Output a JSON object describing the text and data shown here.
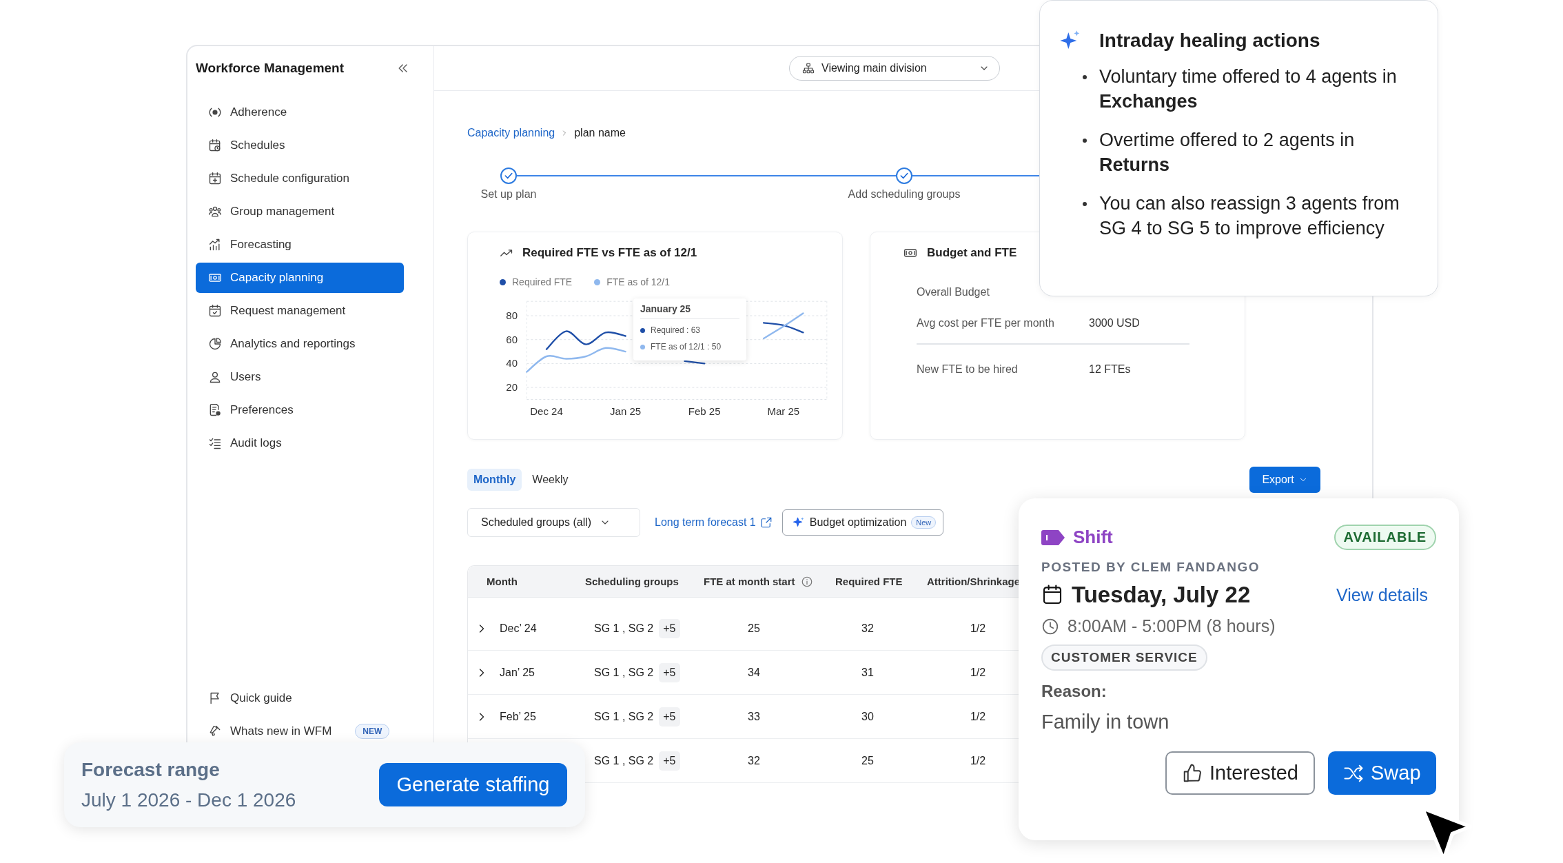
{
  "sidebar": {
    "title": "Workforce Management",
    "items": [
      {
        "label": "Adherence",
        "selected": false
      },
      {
        "label": "Schedules",
        "selected": false
      },
      {
        "label": "Schedule configuration",
        "selected": false
      },
      {
        "label": "Group management",
        "selected": false
      },
      {
        "label": "Forecasting",
        "selected": false
      },
      {
        "label": "Capacity planning",
        "selected": true
      },
      {
        "label": "Request management",
        "selected": false
      },
      {
        "label": "Analytics and reportings",
        "selected": false
      },
      {
        "label": "Users",
        "selected": false
      },
      {
        "label": "Preferences",
        "selected": false
      },
      {
        "label": "Audit logs",
        "selected": false
      }
    ],
    "footer_items": [
      {
        "label": "Quick guide"
      },
      {
        "label": "Whats new in WFM",
        "badge": "NEW"
      }
    ]
  },
  "header": {
    "division_selector": "Viewing main division"
  },
  "breadcrumb": [
    {
      "label": "Capacity planning",
      "kind": "link"
    },
    {
      "label": "plan name",
      "kind": "current"
    }
  ],
  "stepper": [
    {
      "label": "Set up plan",
      "done": true
    },
    {
      "label": "Add scheduling groups",
      "done": true
    }
  ],
  "chart_card": {
    "title": "Required FTE vs FTE as of 12/1",
    "chart_data": {
      "type": "line",
      "categories": [
        null,
        "Dec 24",
        null,
        null,
        null,
        "Jan 25",
        null,
        null,
        null,
        "Feb 25",
        null,
        null,
        null,
        "Mar 25",
        null,
        null
      ],
      "ylim": [
        10,
        92
      ],
      "grid": true,
      "yticks": [
        20,
        40,
        60,
        80
      ],
      "series": [
        {
          "name": "Required FTE",
          "color": "#1f4fa8",
          "values": [
            null,
            52,
            67,
            56,
            66,
            63,
            null,
            null,
            42,
            40,
            null,
            null,
            74,
            72,
            66,
            null
          ]
        },
        {
          "name": "FTE as of 12/1",
          "color": "#8fb8ee",
          "values": [
            33,
            46,
            44,
            46,
            53,
            50,
            null,
            null,
            null,
            null,
            null,
            null,
            61,
            71,
            82,
            null
          ]
        }
      ]
    },
    "tooltip": {
      "title": "January 25",
      "items": [
        {
          "label": "Required : 63",
          "color": "#1f4fa8"
        },
        {
          "label": "FTE as of 12/1 : 50",
          "color": "#8fb8ee"
        }
      ]
    }
  },
  "budget_card": {
    "title": "Budget and FTE",
    "rows": [
      {
        "label": "Overall Budget"
      },
      {
        "label": "Avg cost per FTE per month",
        "value": "3000 USD"
      },
      {
        "label": "New FTE to be hired",
        "value": "12 FTEs"
      }
    ]
  },
  "view_tabs": [
    {
      "label": "Monthly",
      "selected": true
    },
    {
      "label": "Weekly",
      "selected": false
    }
  ],
  "export_button": "Export",
  "filters": {
    "group_select": "Scheduled groups (all)",
    "forecast_link": "Long term forecast 1",
    "optimization_button": {
      "label": "Budget optimization",
      "badge": "New"
    }
  },
  "table": {
    "columns": [
      "Month",
      "Scheduling groups",
      "FTE at month start",
      "Required FTE",
      "Attrition/Shrinkage"
    ],
    "rows": [
      {
        "month": "Dec’ 24",
        "expanded": false,
        "groups": "SG 1 , SG 2",
        "more": "+5",
        "fte_start": "25",
        "required": "32",
        "attrition": "1/2"
      },
      {
        "month": "Jan’ 25",
        "expanded": false,
        "groups": "SG 1 , SG 2",
        "more": "+5",
        "fte_start": "34",
        "required": "31",
        "attrition": "1/2"
      },
      {
        "month": "Feb’ 25",
        "expanded": false,
        "groups": "SG 1 , SG 2",
        "more": "+5",
        "fte_start": "33",
        "required": "30",
        "attrition": "1/2"
      },
      {
        "groups": "SG 1 , SG 2",
        "more": "+5",
        "fte_start": "32",
        "required": "25",
        "attrition": "1/2"
      }
    ]
  },
  "healing_popup": {
    "title": "Intraday healing actions",
    "items": [
      "Voluntary time offered to 4 agents in **Exchanges**",
      "Overtime offered to 2 agents in **Returns**",
      "You can also reassign 3 agents from SG 4 to SG 5 to improve efficiency"
    ]
  },
  "shift_card": {
    "type_label": "Shift",
    "status": "AVAILABLE",
    "posted_by": "POSTED BY CLEM FANDANGO",
    "date": "Tuesday, July 22",
    "details_link": "View details",
    "time": "8:00AM - 5:00PM (8 hours)",
    "department": "CUSTOMER SERVICE",
    "reason_label": "Reason:",
    "reason": "Family in town",
    "buttons": [
      {
        "label": "Interested",
        "kind": "secondary"
      },
      {
        "label": "Swap",
        "kind": "primary"
      }
    ]
  },
  "forecast_card": {
    "title": "Forecast range",
    "range": "July 1 2026 - Dec 1 2026",
    "button": "Generate staffing"
  }
}
